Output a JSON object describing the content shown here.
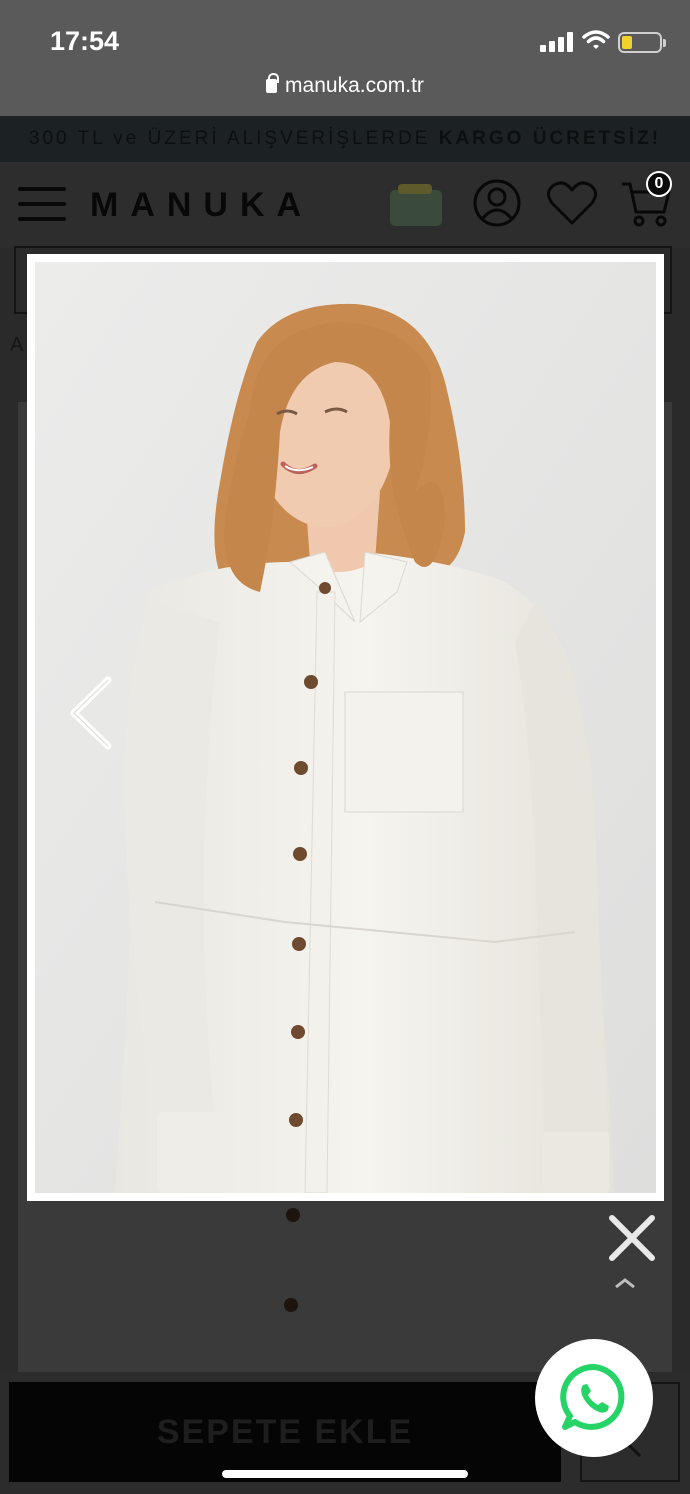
{
  "status": {
    "time": "17:54",
    "url": "manuka.com.tr"
  },
  "promo": {
    "text": "300 TL ve ÜZERİ ALIŞVERİŞLERDE ",
    "bold": "KARGO ÜCRETSİZ!"
  },
  "header": {
    "logo": "MANUKA",
    "cart_count": "0"
  },
  "breadcrumb": {
    "partial": "A"
  },
  "product": {
    "add_to_cart": "SEPETE EKLE"
  },
  "lightbox": {
    "close_label": "",
    "prev_label": ""
  },
  "icons": [
    "lock-icon",
    "signal-icon",
    "wifi-icon",
    "battery-icon",
    "menu-icon",
    "gift-box-icon",
    "user-icon",
    "heart-icon",
    "cart-icon",
    "chevron-left-icon",
    "close-icon",
    "chevron-up-icon",
    "whatsapp-icon"
  ],
  "colors": {
    "accent_whatsapp": "#25D366",
    "overlay": "#000000",
    "battery": "#f1d12a"
  }
}
